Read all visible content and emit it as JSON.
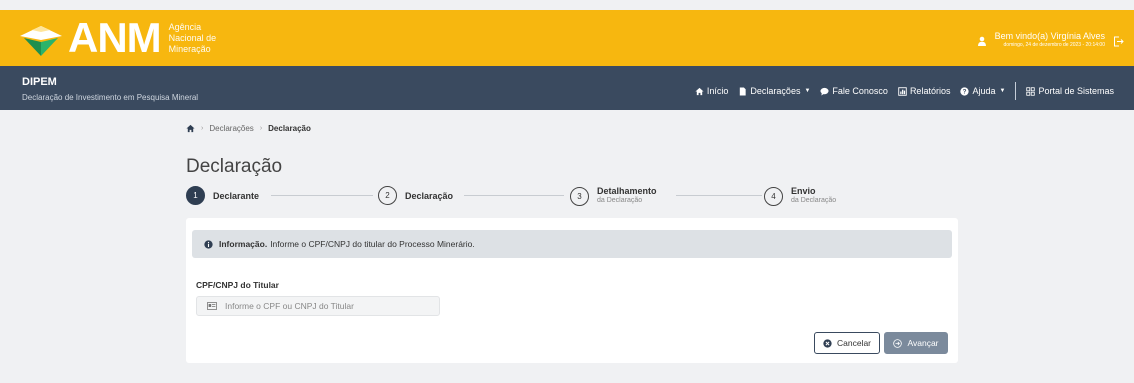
{
  "header": {
    "logo_text": "ANM",
    "logo_sub": [
      "Agência",
      "Nacional de",
      "Mineração"
    ],
    "user_name": "Bem vindo(a) Virgínia Alves",
    "user_date": "domingo, 24 de dezembro de 2023 - 20:14:00"
  },
  "navbar": {
    "brand_title": "DIPEM",
    "brand_sub": "Declaração de Investimento em Pesquisa Mineral",
    "menu": [
      {
        "label": "Início",
        "icon": "home-icon"
      },
      {
        "label": "Declarações",
        "icon": "document-icon"
      },
      {
        "label": "Fale Conosco",
        "icon": "chat-icon"
      },
      {
        "label": "Relatórios",
        "icon": "chart-icon"
      },
      {
        "label": "Ajuda",
        "icon": "question-icon"
      },
      {
        "label": "Portal de Sistemas",
        "icon": "grid-icon"
      }
    ]
  },
  "breadcrumb": {
    "items": [
      "Declarações",
      "Declaração"
    ]
  },
  "page": {
    "title": "Declaração"
  },
  "stepper": {
    "steps": [
      {
        "number": "1",
        "title": "Declarante",
        "sub": ""
      },
      {
        "number": "2",
        "title": "Declaração",
        "sub": ""
      },
      {
        "number": "3",
        "title": "Detalhamento",
        "sub": "da Declaração"
      },
      {
        "number": "4",
        "title": "Envio",
        "sub": "da Declaração"
      }
    ]
  },
  "alert": {
    "strong": "Informação.",
    "text": "Informe o CPF/CNPJ do titular do Processo Minerário."
  },
  "form": {
    "label": "CPF/CNPJ do Titular",
    "placeholder": "Informe o CPF ou CNPJ do Titular",
    "value": ""
  },
  "actions": {
    "cancel": "Cancelar",
    "next": "Avançar"
  },
  "colors": {
    "header_yellow": "#f7b70f",
    "navbar": "#3a4a5f",
    "active_step": "#2f3e52",
    "next_button": "#7b8a9c"
  }
}
